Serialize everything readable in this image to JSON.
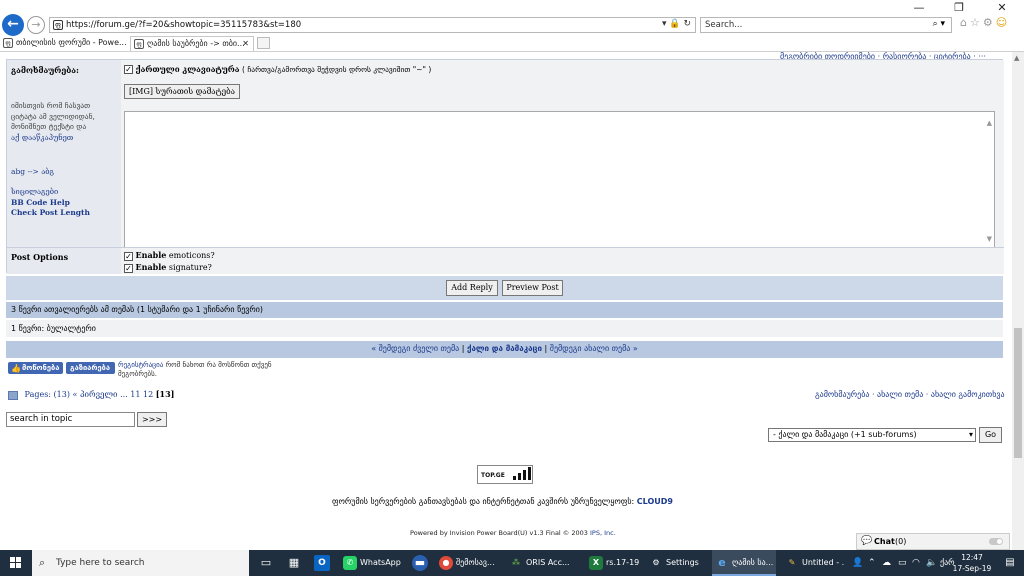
{
  "browser": {
    "address": "https://forum.ge/?f=20&showtopic=35115783&st=180",
    "search_placeholder": "Search...",
    "tabs": [
      {
        "label": "თბილისის ფორუმი - Powe..."
      },
      {
        "label": "ღამის საუბრები -> თბი..."
      }
    ]
  },
  "page": {
    "top_links": "მეგობრიბი თოდრიიმები · რასიორება · ციტირება · ···",
    "form": {
      "options_label": "გამოხმაურება:",
      "keyboard_label": "ქართული კლავიატურა",
      "keyboard_note": "( ჩართვა/გამორთვა შეჭდვის დროს კლავიშით \"~\" )",
      "img_button": "[IMG] სურათის დამატება",
      "side_note": "იმისთვის რომ ჩასვათ ციტატა ამ ველიდიდან, მონიშნეთ ტექსტი და",
      "side_link": "აქ დააწკაპუნეთ",
      "abg_link": "abg --> აბგ",
      "dictionary_link": "სიცილაგები",
      "bbcode_link": "BB Code Help",
      "check_length_link": "Check Post Length",
      "post_options_label": "Post Options",
      "enable_emoticons_bold": "Enable",
      "enable_emoticons_rest": "emoticons?",
      "enable_signature_bold": "Enable",
      "enable_signature_rest": "signature?",
      "add_reply": "Add Reply",
      "preview_post": "Preview Post"
    },
    "active_users": "3 წევრი ათვალიერებს ამ თემას (1 სტუმარი და 1 უჩინარი წევრი)",
    "users_list": "1 წევრი: ბულალტერი",
    "nav": {
      "prev": "« შემდეგი ძველი თემა",
      "current": "ქალი და მამაკაცი",
      "next": "შემდეგი ახალი თემა »"
    },
    "fb": {
      "like": "მოწონება",
      "share": "გაზიარება",
      "register_link": "რეგისტრაცია",
      "register_text": "რომ ნახოთ რა მოსწონთ თქვენ",
      "register_text2": "მეგობრებს."
    },
    "pages": {
      "label": "Pages:",
      "count": "(13)",
      "first": "« პირველი",
      "dots": "...",
      "p11": "11",
      "p12": "12",
      "current": "[13]"
    },
    "right_links": "გამოხმაურება · ახალი თემა · ახალი გამოკითხვა",
    "topic_search_value": "search in topic",
    "topic_search_go": ">>>",
    "forum_select": "- ქალი და მამაკაცი (+1 sub-forums)",
    "forum_go": "Go",
    "topge_label": "TOP.GE",
    "server_text": "ფორუმის სერვერების განთავსებას და ინტერნეტთან კავშირს უზრუნველყოფს:",
    "server_brand": "CLOUD9",
    "powered_text": "Powered by Invision Power Board(U) v1.3 Final © 2003",
    "powered_brand": "IPS, Inc.",
    "chat_label": "Chat",
    "chat_count": "(0)"
  },
  "taskbar": {
    "search_placeholder": "Type here to search",
    "apps": [
      {
        "label": "WhatsApp"
      },
      {
        "label": "შემოსავ..."
      },
      {
        "label": "ORIS Acc..."
      },
      {
        "label": "rs.17-19 [..."
      },
      {
        "label": "Settings"
      },
      {
        "label": "ღამის სა..."
      },
      {
        "label": "Untitled - ..."
      }
    ],
    "lang": "ქარ",
    "time": "12:47",
    "date": "17-Sep-19"
  },
  "colors": {
    "link": "#1c3a8c",
    "row_blue": "#b8c8e0",
    "taskbar": "#1f2f3f",
    "fb_blue": "#4267b2"
  }
}
